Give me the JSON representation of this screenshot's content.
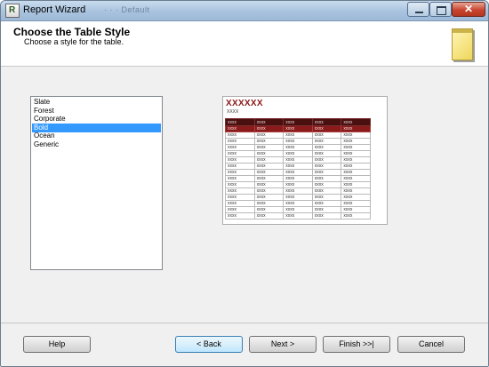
{
  "window": {
    "title": "Report Wizard",
    "background_title": "· · ·  Default"
  },
  "header": {
    "title": "Choose the Table Style",
    "subtitle": "Choose a style for the table."
  },
  "style_list": {
    "items": [
      "Slate",
      "Forest",
      "Corporate",
      "Bold",
      "Ocean",
      "Generic"
    ],
    "selected": "Bold"
  },
  "preview": {
    "title": "XXXXXX",
    "subtitle": "XXXX",
    "cell_text": "xxxx",
    "header_color": "#4a0f0f",
    "accent_color": "#8b1a1a",
    "rows": 16,
    "cols": 5
  },
  "buttons": {
    "help": "Help",
    "back": "< Back",
    "next": "Next >",
    "finish": "Finish >>|",
    "cancel": "Cancel"
  }
}
